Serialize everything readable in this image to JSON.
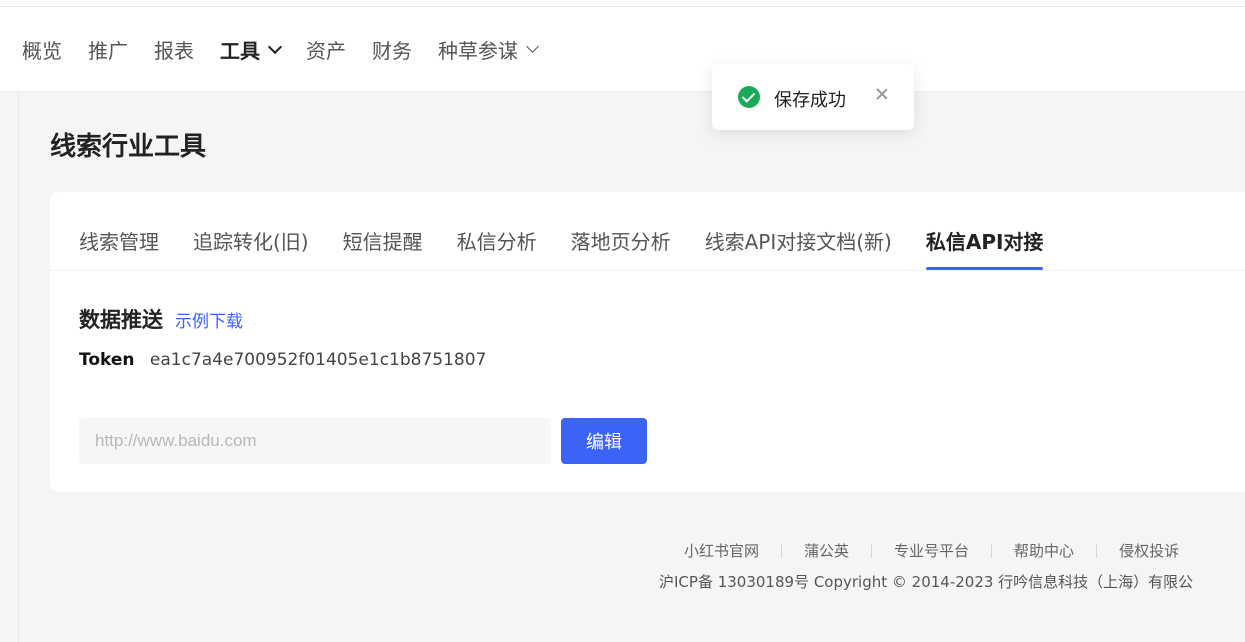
{
  "nav": {
    "items": [
      {
        "label": "概览",
        "active": false,
        "dropdown": false
      },
      {
        "label": "推广",
        "active": false,
        "dropdown": false
      },
      {
        "label": "报表",
        "active": false,
        "dropdown": false
      },
      {
        "label": "工具",
        "active": true,
        "dropdown": true
      },
      {
        "label": "资产",
        "active": false,
        "dropdown": false
      },
      {
        "label": "财务",
        "active": false,
        "dropdown": false
      },
      {
        "label": "种草参谋",
        "active": false,
        "dropdown": true
      }
    ]
  },
  "page": {
    "title": "线索行业工具"
  },
  "tabs": [
    {
      "label": "线索管理",
      "active": false
    },
    {
      "label": "追踪转化(旧)",
      "active": false
    },
    {
      "label": "短信提醒",
      "active": false
    },
    {
      "label": "私信分析",
      "active": false
    },
    {
      "label": "落地页分析",
      "active": false
    },
    {
      "label": "线索API对接文档(新)",
      "active": false
    },
    {
      "label": "私信API对接",
      "active": true
    }
  ],
  "data_push": {
    "title": "数据推送",
    "sample_link": "示例下载",
    "token_label": "Token",
    "token_value": "ea1c7a4e700952f01405e1c1b8751807",
    "url_placeholder": "http://www.baidu.com",
    "url_value": "",
    "edit_button": "编辑"
  },
  "footer": {
    "links": [
      "小红书官网",
      "蒲公英",
      "专业号平台",
      "帮助中心",
      "侵权投诉"
    ],
    "copyright": "沪ICP备 13030189号 Copyright © 2014-2023 行吟信息科技（上海）有限公"
  },
  "toast": {
    "message": "保存成功",
    "icon": "check-circle-icon",
    "close_icon": "close-icon"
  },
  "colors": {
    "accent": "#3b63f5",
    "success": "#1aaa55",
    "background": "#f5f5f5"
  }
}
